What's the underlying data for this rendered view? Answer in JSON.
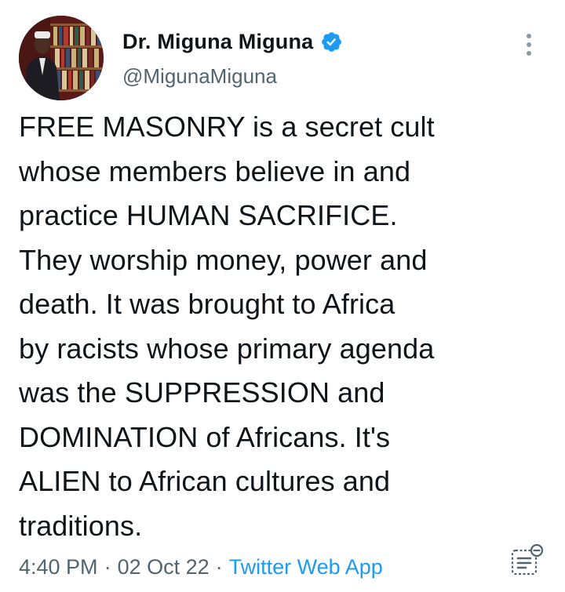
{
  "author": {
    "display_name": "Dr. Miguna Miguna",
    "handle": "@MigunaMiguna",
    "verified": true
  },
  "tweet": {
    "text": "FREE MASONRY is a secret cult\nwhose members believe in and\npractice HUMAN SACRIFICE.\nThey worship money, power and\ndeath. It was brought to Africa\nby racists whose primary agenda\nwas the SUPPRESSION and\nDOMINATION of Africans. It's\nALIEN to African cultures and\ntraditions."
  },
  "meta": {
    "time": "4:40 PM",
    "separator": "·",
    "date": "02 Oct 22",
    "source": "Twitter Web App"
  },
  "icons": {
    "verified": "verified-badge-icon",
    "more": "more-options-icon",
    "analytics": "tweet-analytics-icon"
  },
  "colors": {
    "text": "#0f1419",
    "secondary": "#536471",
    "accent": "#1d9bf0"
  }
}
